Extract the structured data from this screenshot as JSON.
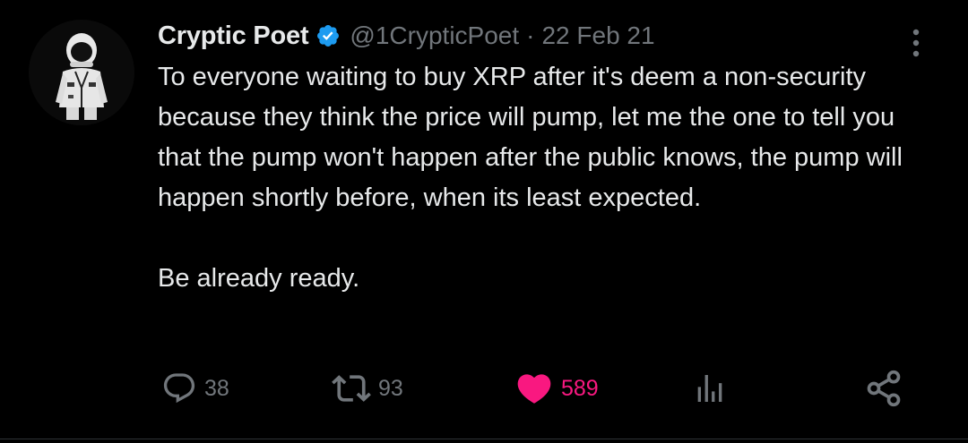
{
  "tweet": {
    "author": {
      "name": "Cryptic Poet",
      "handle": "@1CrypticPoet",
      "verified": true
    },
    "separator": "·",
    "date": "22 Feb 21",
    "text": {
      "paragraph1": "To everyone waiting to buy XRP after it's deem a non-security because they think the price will pump, let me the one to tell you that the pump won't happen after the public knows, the pump will happen shortly before, when its least expected.",
      "paragraph2": "Be already ready."
    },
    "stats": {
      "replies": "38",
      "retweets": "93",
      "likes": "589"
    }
  },
  "icons": {
    "avatar": "astronaut-suit-avatar",
    "verified": "verified-badge-icon",
    "more": "more-vertical-icon",
    "reply": "reply-bubble-icon",
    "retweet": "retweet-icon",
    "like": "heart-icon",
    "views": "analytics-bars-icon",
    "share": "share-nodes-icon"
  },
  "colors": {
    "background": "#000000",
    "primary_text": "#e7e9ea",
    "secondary_text": "#71767b",
    "verified_blue": "#1d9bf0",
    "like_pink": "#f91880"
  }
}
